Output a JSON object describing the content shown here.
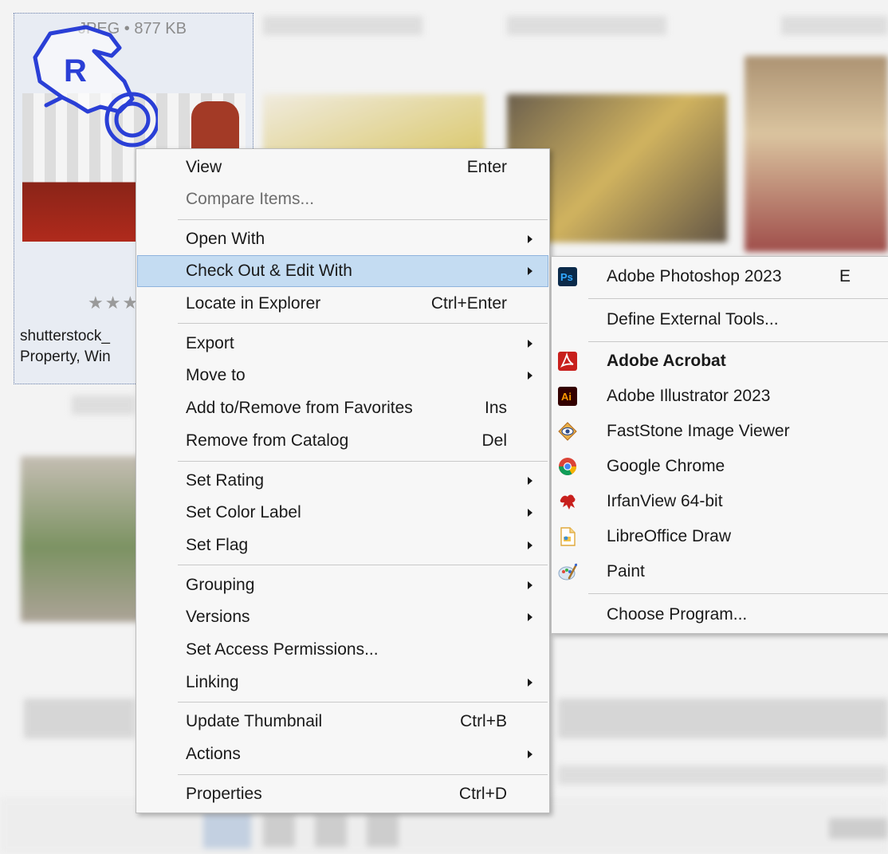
{
  "gallery": {
    "selected": {
      "caption": "JPEG • 877 KB",
      "rating": "★★★",
      "name_line1": "shutterstock_",
      "name_line2": "Property, Win"
    }
  },
  "cursor": {
    "letter": "R"
  },
  "context_menu": {
    "items": [
      {
        "label": "View",
        "shortcut": "Enter"
      },
      {
        "label": "Compare Items..."
      },
      {
        "label": "Open With"
      },
      {
        "label": "Check Out & Edit With"
      },
      {
        "label": "Locate in Explorer",
        "shortcut": "Ctrl+Enter"
      },
      {
        "label": "Export"
      },
      {
        "label": "Move to"
      },
      {
        "label": "Add to/Remove from Favorites",
        "shortcut": "Ins"
      },
      {
        "label": "Remove from Catalog",
        "shortcut": "Del"
      },
      {
        "label": "Set Rating"
      },
      {
        "label": "Set Color Label"
      },
      {
        "label": "Set Flag"
      },
      {
        "label": "Grouping"
      },
      {
        "label": "Versions"
      },
      {
        "label": "Set Access Permissions..."
      },
      {
        "label": "Linking"
      },
      {
        "label": "Update Thumbnail",
        "shortcut": "Ctrl+B"
      },
      {
        "label": "Actions"
      },
      {
        "label": "Properties",
        "shortcut": "Ctrl+D"
      }
    ]
  },
  "submenu": {
    "items": [
      {
        "label": "Adobe Photoshop 2023",
        "shortcut": "E",
        "icon": "photoshop-icon"
      },
      {
        "label": "Define External Tools..."
      },
      {
        "label": "Adobe Acrobat",
        "icon": "acrobat-icon"
      },
      {
        "label": "Adobe Illustrator 2023",
        "icon": "illustrator-icon"
      },
      {
        "label": "FastStone Image Viewer",
        "icon": "faststone-icon"
      },
      {
        "label": "Google Chrome",
        "icon": "chrome-icon"
      },
      {
        "label": "IrfanView 64-bit",
        "icon": "irfanview-icon"
      },
      {
        "label": "LibreOffice Draw",
        "icon": "libreoffice-draw-icon"
      },
      {
        "label": "Paint",
        "icon": "paint-icon"
      },
      {
        "label": "Choose Program..."
      }
    ]
  },
  "colors": {
    "highlight": "#c4dcf2",
    "cursor_blue": "#2a3fd6",
    "photoshop": "#0b2a4a",
    "acrobat": "#c8201d",
    "illustrator": "#330000"
  }
}
